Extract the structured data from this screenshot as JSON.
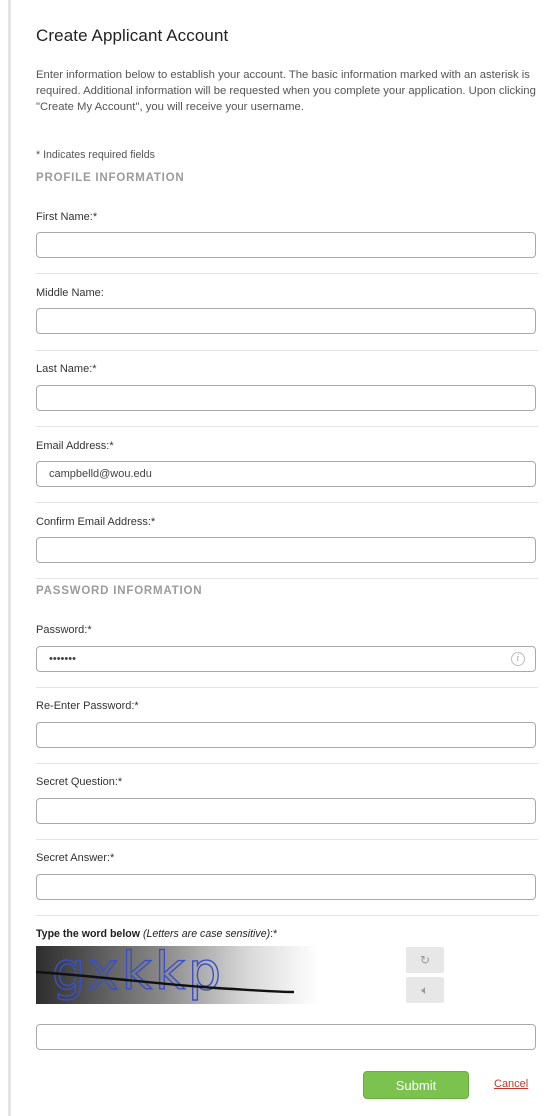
{
  "page": {
    "title": "Create Applicant Account",
    "intro": "Enter information below to establish your account. The basic information marked with an asterisk is required. Additional information will be requested when you complete your application. Upon clicking \"Create My Account\", you will receive your username.",
    "required_note": "* Indicates required fields"
  },
  "sections": {
    "profile": "PROFILE INFORMATION",
    "password": "PASSWORD INFORMATION"
  },
  "fields": {
    "first_name": {
      "label": "First Name:*",
      "value": ""
    },
    "middle_name": {
      "label": "Middle Name:",
      "value": ""
    },
    "last_name": {
      "label": "Last Name:*",
      "value": ""
    },
    "email": {
      "label": "Email Address:*",
      "value": "campbelld@wou.edu"
    },
    "confirm_email": {
      "label": "Confirm Email Address:*",
      "value": ""
    },
    "password": {
      "label": "Password:*",
      "value": "•••••••"
    },
    "reenter_password": {
      "label": "Re-Enter Password:*",
      "value": ""
    },
    "secret_question": {
      "label": "Secret Question:*",
      "value": ""
    },
    "secret_answer": {
      "label": "Secret Answer:*",
      "value": ""
    }
  },
  "captcha": {
    "label_bold": "Type the word below",
    "label_italic": "(Letters are case sensitive)",
    "label_suffix": ":*",
    "word": "gxkkp",
    "value": ""
  },
  "icons": {
    "info": "info-icon",
    "refresh": "refresh-icon",
    "audio": "speaker-icon"
  },
  "actions": {
    "submit": "Submit",
    "cancel": "Cancel"
  },
  "colors": {
    "submit_bg": "#7cc24f",
    "cancel_link": "#c0392b",
    "section_title": "#9b9b9b"
  }
}
